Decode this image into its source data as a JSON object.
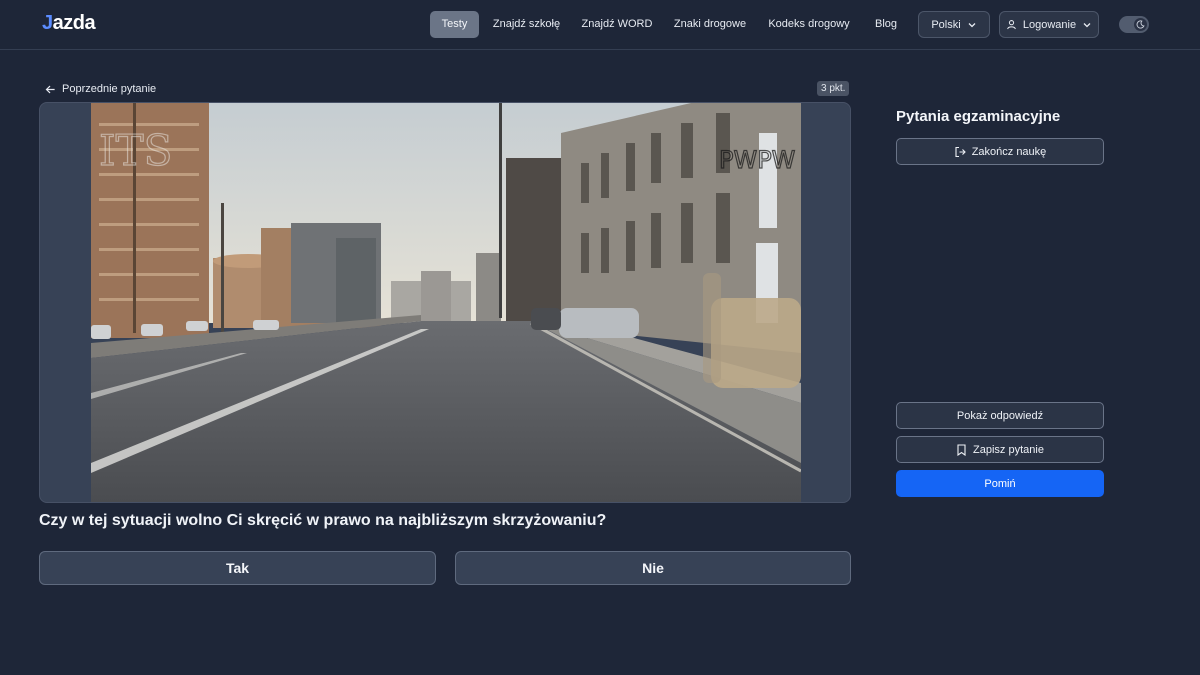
{
  "header": {
    "logo": {
      "accent": "J",
      "rest": "azda"
    },
    "nav": [
      {
        "label": "Testy",
        "active": true
      },
      {
        "label": "Znajdź szkołę"
      },
      {
        "label": "Znajdź WORD"
      },
      {
        "label": "Znaki drogowe"
      },
      {
        "label": "Kodeks drogowy"
      },
      {
        "label": "Blog"
      }
    ],
    "language_label": "Polski",
    "login_label": "Logowanie",
    "theme_toggle": {
      "icon": "moon-icon",
      "state": "dark"
    }
  },
  "question_panel": {
    "back_label": "Poprzednie pytanie",
    "points": "3 pkt.",
    "image": {
      "watermark_left": "ITS",
      "watermark_right": "PWPW"
    },
    "question_text": "Czy w tej sytuacji wolno Ci skręcić w prawo na najbliższym skrzyżowaniu?",
    "answers": [
      {
        "label": "Tak"
      },
      {
        "label": "Nie"
      }
    ]
  },
  "sidebar": {
    "title": "Pytania egzaminacyjne",
    "end_study_label": "Zakończ naukę",
    "show_answer_label": "Pokaż odpowiedź",
    "save_question_label": "Zapisz pytanie",
    "skip_label": "Pomiń"
  },
  "colors": {
    "background": "#1e2638",
    "accent": "#1565f5",
    "logo_accent": "#5b8cff"
  }
}
